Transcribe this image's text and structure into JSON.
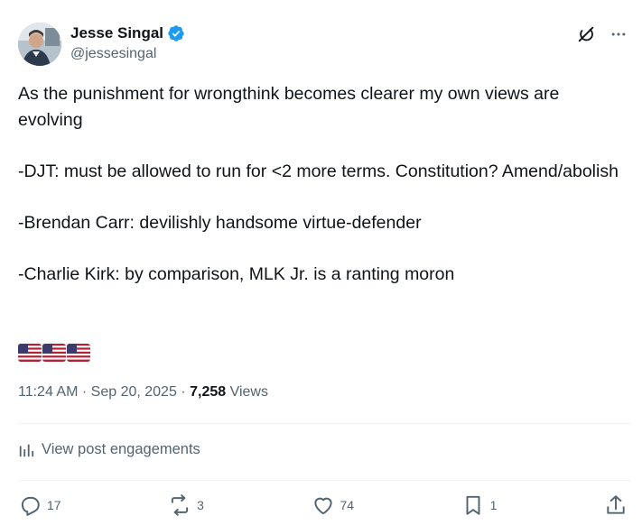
{
  "author": {
    "display_name": "Jesse Singal",
    "handle": "@jessesingal",
    "verified": true
  },
  "tweet": {
    "lines": [
      "As the punishment for wrongthink becomes clearer my own views are evolving",
      "-DJT: must be allowed to run for <2 more terms. Constitution? Amend/abolish",
      "-Brendan Carr: devilishly handsome virtue-defender",
      "-Charlie Kirk: by comparison, MLK Jr. is a ranting moron"
    ],
    "emoji": [
      "us-flag",
      "us-flag",
      "us-flag"
    ]
  },
  "meta": {
    "time": "11:24 AM",
    "separator": "·",
    "date": "Sep 20, 2025",
    "views_count": "7,258",
    "views_label": "Views"
  },
  "engagements": {
    "label": "View post engagements"
  },
  "actions": {
    "replies": "17",
    "reposts": "3",
    "likes": "74",
    "bookmarks": "1"
  },
  "icons": {
    "verified_color": "#1d9bf0",
    "action_color": "#536471"
  }
}
